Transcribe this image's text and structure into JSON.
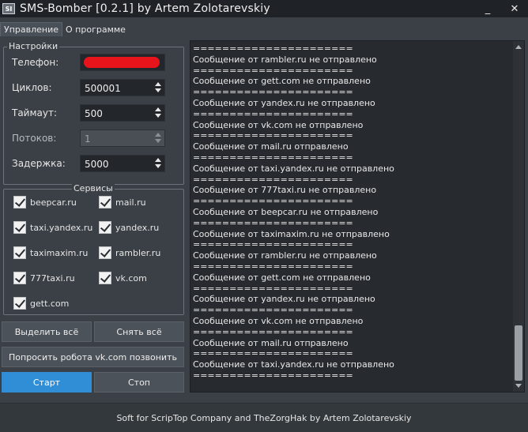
{
  "window": {
    "icon_text": "SI",
    "title": "SMS-Bomber [0.2.1] by Artem Zolotarevskiy",
    "controls": {
      "minimize": "_",
      "close": "✕"
    }
  },
  "tabs": [
    {
      "label": "Управление",
      "active": true
    },
    {
      "label": "О программе",
      "active": false
    }
  ],
  "settings": {
    "group_title": "Настройки",
    "phone": {
      "label": "Телефон:",
      "value": "+",
      "redacted": true
    },
    "cycles": {
      "label": "Циклов:",
      "value": "500001"
    },
    "timeout": {
      "label": "Таймаут:",
      "value": "500"
    },
    "threads": {
      "label": "Потоков:",
      "value": "1",
      "disabled": true
    },
    "delay": {
      "label": "Задержка:",
      "value": "5000"
    }
  },
  "services": {
    "group_title": "Сервисы",
    "items": [
      {
        "label": "beepcar.ru",
        "checked": true
      },
      {
        "label": "mail.ru",
        "checked": true
      },
      {
        "label": "taxi.yandex.ru",
        "checked": true
      },
      {
        "label": "yandex.ru",
        "checked": true
      },
      {
        "label": "taximaxim.ru",
        "checked": true
      },
      {
        "label": "rambler.ru",
        "checked": true
      },
      {
        "label": "777taxi.ru",
        "checked": true
      },
      {
        "label": "vk.com",
        "checked": true
      },
      {
        "label": "gett.com",
        "checked": true
      }
    ]
  },
  "buttons": {
    "select_all": "Выделить всё",
    "deselect_all": "Снять всё",
    "ask_robot": "Попросить робота vk.com позвонить",
    "start": "Старт",
    "stop": "Стоп"
  },
  "log": {
    "lines": [
      "======================",
      "Сообщение от rambler.ru не отправлено",
      "======================",
      "Сообщение от gett.com не отправлено",
      "======================",
      "Сообщение от yandex.ru не отправлено",
      "======================",
      "Сообщение от vk.com не отправлено",
      "======================",
      "Сообщение от mail.ru отправлено",
      "======================",
      "Сообщение от taxi.yandex.ru не отправлено",
      "======================",
      "Сообщение от 777taxi.ru не отправлено",
      "======================",
      "Сообщение от beepcar.ru не отправлено",
      "======================",
      "Сообщение от taximaxim.ru не отправлено",
      "======================",
      "Сообщение от rambler.ru не отправлено",
      "======================",
      "Сообщение от gett.com не отправлено",
      "======================",
      "Сообщение от yandex.ru не отправлено",
      "======================",
      "Сообщение от vk.com не отправлено",
      "======================",
      "Сообщение от mail.ru отправлено",
      "======================",
      "Сообщение от taxi.yandex.ru не отправлено",
      "======================"
    ]
  },
  "footer": {
    "text": "Soft for ScripTop Company and TheZorgHak by Artem Zolotarevskiy"
  },
  "colors": {
    "accent": "#2f8ed6",
    "background": "#3b4046",
    "log_background": "#272b30",
    "redaction": "#e8141b"
  }
}
